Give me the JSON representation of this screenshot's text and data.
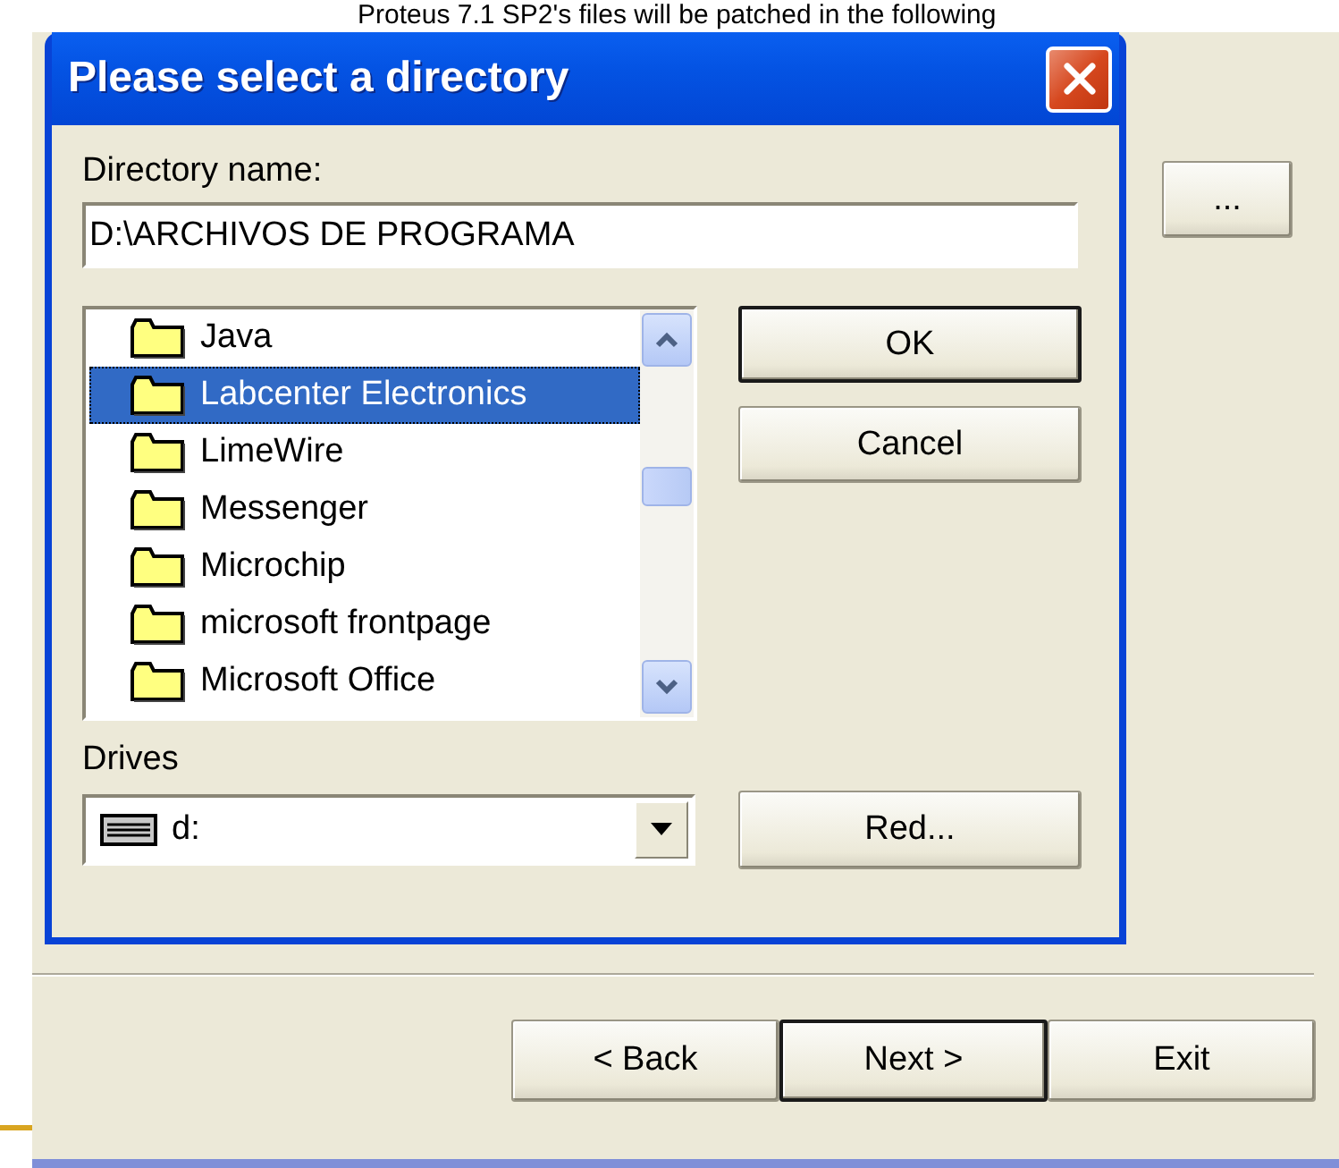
{
  "background_window": {
    "header_text": "Proteus 7.1 SP2's files will be patched in the following",
    "browse_button": "..."
  },
  "dialog": {
    "title": "Please select a directory",
    "directory_label": "Directory name:",
    "directory_value": "D:\\ARCHIVOS DE PROGRAMA",
    "folders": [
      {
        "name": "Java",
        "selected": false
      },
      {
        "name": "Labcenter Electronics",
        "selected": true
      },
      {
        "name": "LimeWire",
        "selected": false
      },
      {
        "name": "Messenger",
        "selected": false
      },
      {
        "name": "Microchip",
        "selected": false
      },
      {
        "name": "microsoft frontpage",
        "selected": false
      },
      {
        "name": "Microsoft Office",
        "selected": false
      }
    ],
    "buttons": [
      {
        "label": "OK",
        "default": true
      },
      {
        "label": "Cancel",
        "default": false
      }
    ],
    "drives_label": "Drives",
    "drive": "d:",
    "network_button": {
      "label": "Red...",
      "default": false
    }
  },
  "wizard_buttons": [
    {
      "label": "< Back",
      "default": false
    },
    {
      "label": "Next >",
      "default": true
    },
    {
      "label": "Exit",
      "default": false
    }
  ]
}
